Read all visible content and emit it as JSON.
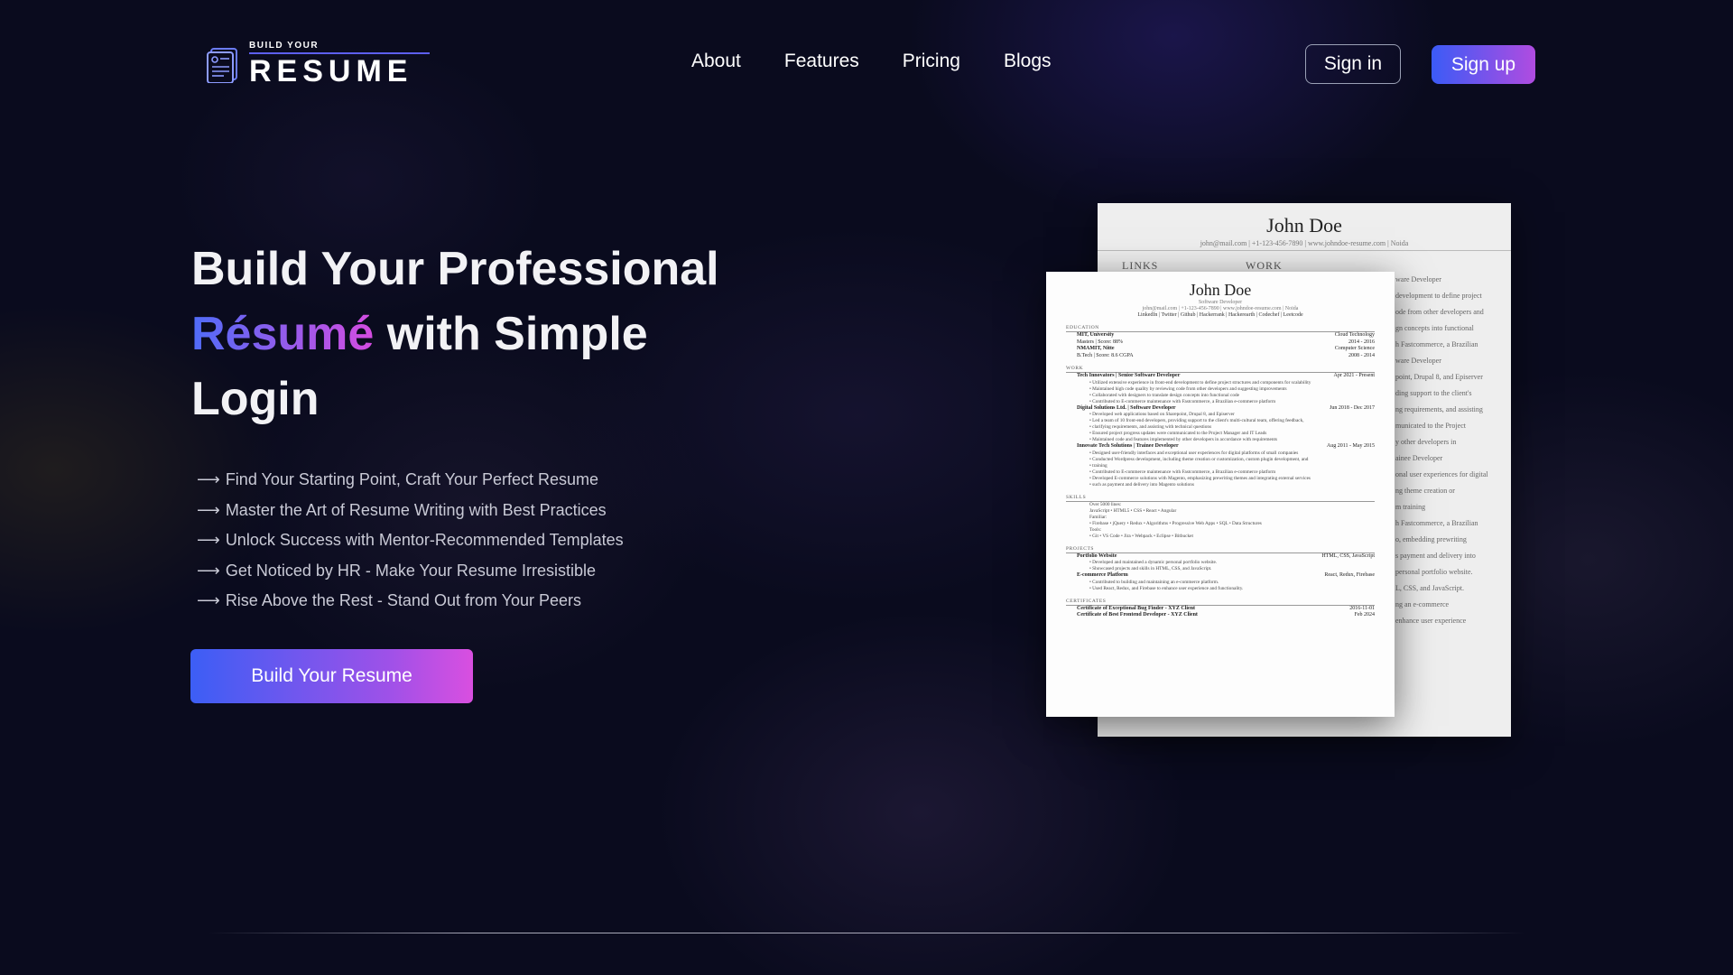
{
  "brand": {
    "top": "BUILD YOUR",
    "main": "RESUME"
  },
  "nav": {
    "items": [
      "About",
      "Features",
      "Pricing",
      "Blogs"
    ]
  },
  "auth": {
    "signin": "Sign in",
    "signup": "Sign up"
  },
  "hero": {
    "title_line1": "Build Your Professional",
    "title_accent": "Résumé",
    "title_rest": " with Simple",
    "title_line3": "Login",
    "features": [
      "Find Your Starting Point, Craft Your Perfect Resume",
      "Master the Art of Resume Writing with Best Practices",
      "Unlock Success with Mentor-Recommended Templates",
      "Get Noticed by HR - Make Your Resume Irresistible",
      "Rise Above the Rest - Stand Out from Your Peers"
    ],
    "cta": "Build Your Resume",
    "arrow": "⟶"
  },
  "resume_back": {
    "name": "John Doe",
    "contact": "john@mail.com | +1-123-456-7890 | www.johndoe-resume.com | Noida",
    "links_heading": "LINKS",
    "work_heading": "WORK",
    "right_snippets": [
      "ware Developer",
      "development to define project",
      "ode from other developers and",
      "gn concepts into functional",
      "h Fastcommerce, a Brazilian",
      "ware Developer",
      "point, Drupal 8, and Episerver",
      "ding support to the client's",
      "ng requirements, and assisting",
      "municated to the Project",
      "y other developers in",
      "ainee Developer",
      "onal user experiences for digital",
      "ng theme creation or",
      "m training",
      "h Fastcommerce, a Brazilian",
      "o, embedding prewriting",
      "s payment and delivery into",
      "personal portfolio website.",
      "L, CSS, and JavaScript.",
      "ng an e-commerce",
      "enhance user experience"
    ]
  },
  "resume_front": {
    "name": "John Doe",
    "role": "Software Developer",
    "contact": "john@mail.com | +1-123-456-7890 | www.johndoe-resume.com | Noida",
    "links": "LinkedIn | Twitter | Github | Hackerrank | Hackerearth | Codechef | Leetcode",
    "sections": {
      "education": "EDUCATION",
      "work": "WORK",
      "skills": "SKILLS",
      "projects": "PROJECTS",
      "certificates": "CERTIFICATES"
    },
    "education": [
      {
        "left": "MIT, University",
        "right": "Cloud Technology",
        "sub_left": "Masters | Score: 88%",
        "sub_right": "2014 - 2016"
      },
      {
        "left": "NMAMIT, Nitte",
        "right": "Computer Science",
        "sub_left": "B.Tech | Score: 8.6 CGPA",
        "sub_right": "2008 - 2014"
      }
    ],
    "work": [
      {
        "left": "Tech Innovators | Senior Software Developer",
        "right": "Apr 2021 - Present",
        "bullets": [
          "Utilized extensive experience in front-end development to define project structures and components for scalability",
          "Maintained high code quality by reviewing code from other developers and suggesting improvements",
          "Collaborated with designers to translate design concepts into functional code",
          "Contributed to E-commerce maintenance with Fastcommerce, a Brazilian e-commerce platform"
        ]
      },
      {
        "left": "Digital Solutions Ltd. | Software Developer",
        "right": "Jun 2018 - Dec 2017",
        "bullets": [
          "Developed web applications based on Sharepoint, Drupal 8, and Episerver",
          "Led a team of 10 front-end developers, providing support to the client's multi-cultural team, offering feedback,",
          "clarifying requirements, and assisting with technical questions",
          "Ensured project progress updates were communicated to the Project Manager and IT Leads",
          "Maintained code and features implemented by other developers in accordance with requirements"
        ]
      },
      {
        "left": "Innovate Tech Solutions | Trainee Developer",
        "right": "Aug 2011 - May 2015",
        "bullets": [
          "Designed user-friendly interfaces and exceptional user experiences for digital platforms of small companies",
          "Conducted Wordpress development, including theme creation or customization, custom plugin development, and",
          "training",
          "Contributed to E-commerce maintenance with Fastcommerce, a Brazilian e-commerce platform",
          "Developed E-commerce solutions with Magento, emphasizing prewriting themes and integrating external services",
          "such as payment and delivery into Magento solutions"
        ]
      }
    ],
    "skills": [
      "Over 5000 lines:",
      "JavaScript • HTML5 • CSS • React • Angular",
      "Familiar:",
      "• Firebase • jQuery • Redux • Algorithms • Progressive Web Apps • SQL • Data Structures",
      "Tools:",
      "• Git • VS Code • Jira • Webpack • Eclipse • Bitbucket"
    ],
    "projects": [
      {
        "left": "Portfolio Website",
        "right": "HTML, CSS, JavaScript",
        "bullets": [
          "Developed and maintained a dynamic personal portfolio website.",
          "Showcased projects and skills in HTML, CSS, and JavaScript."
        ]
      },
      {
        "left": "E-commerce Platform",
        "right": "React, Redux, Firebase",
        "bullets": [
          "Contributed to building and maintaining an e-commerce platform.",
          "Used React, Redux, and Firebase to enhance user experience and functionality."
        ]
      }
    ],
    "certificates": [
      {
        "left": "Certificate of Exceptional Bug Finder - XYZ Client",
        "right": "2016-11-01"
      },
      {
        "left": "Certificate of Best Frontend Developer - XYZ Client",
        "right": "Feb 2024"
      }
    ]
  },
  "colors": {
    "background": "#0a0b1e",
    "accent_start": "#3b5bf6",
    "accent_end": "#d94fe0",
    "text": "#f2f2f5"
  }
}
